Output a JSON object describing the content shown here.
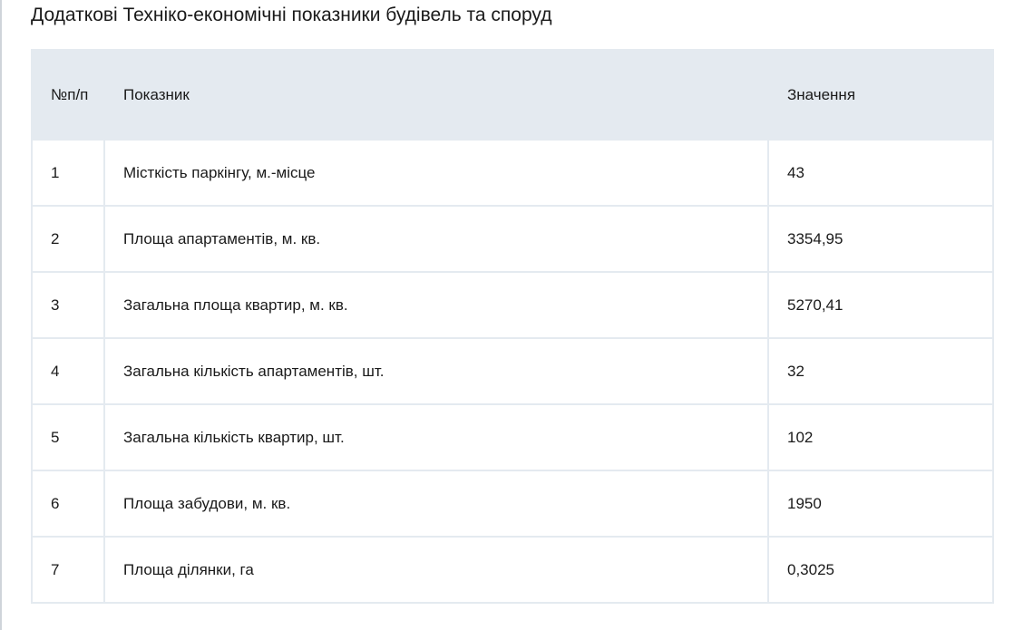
{
  "page": {
    "title": "Додаткові Техніко-економічні показники будівель та споруд"
  },
  "table": {
    "headers": {
      "num": "№п/п",
      "name": "Показник",
      "value": "Значення"
    },
    "rows": [
      {
        "num": "1",
        "name": "Місткість паркінгу, м.-місце",
        "value": "43"
      },
      {
        "num": "2",
        "name": "Площа апартаментів, м. кв.",
        "value": "3354,95"
      },
      {
        "num": "3",
        "name": "Загальна площа квартир, м. кв.",
        "value": "5270,41"
      },
      {
        "num": "4",
        "name": "Загальна кількість апартаментів, шт.",
        "value": "32"
      },
      {
        "num": "5",
        "name": "Загальна кількість квартир, шт.",
        "value": "102"
      },
      {
        "num": "6",
        "name": "Площа забудови, м. кв.",
        "value": "1950"
      },
      {
        "num": "7",
        "name": "Площа ділянки, га",
        "value": "0,3025"
      }
    ]
  }
}
